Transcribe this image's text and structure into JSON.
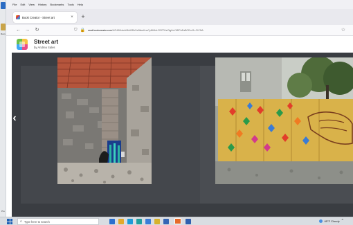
{
  "browser": {
    "menu": [
      "File",
      "Edit",
      "View",
      "History",
      "Bookmarks",
      "Tools",
      "Help"
    ],
    "tab_title": "Book Creator - Street art",
    "tab_close": "×",
    "new_tab": "+",
    "nav": {
      "back": "←",
      "forward": "→",
      "reload": "↻"
    },
    "url_host": "read.bookcreator.com",
    "url_path": "/ihTriDkNxeWMrl0DkSe5kkeKnsCyNMIeLR2Z7HeOigI/uV6DPnEaBCEmGr-CICNA",
    "url_shield": "⛉",
    "url_lock": "🔒",
    "star": "☆"
  },
  "desktop": {
    "label_top": "Recy",
    "label_bottom": "Pro"
  },
  "book": {
    "title": "Street art",
    "author": "by Andrea Sales"
  },
  "reader": {
    "prev_arrow": "‹"
  },
  "taskbar": {
    "search_placeholder": "Type here to search",
    "weather": "65°F Cloudy",
    "tray_arrow": "^"
  },
  "colors": {
    "reader_bg": "#3a3d42",
    "brand_yellow": "#f6c343",
    "brand_pink": "#e84e89",
    "brand_blue": "#3fa9f5",
    "brand_green": "#6cc04a"
  }
}
